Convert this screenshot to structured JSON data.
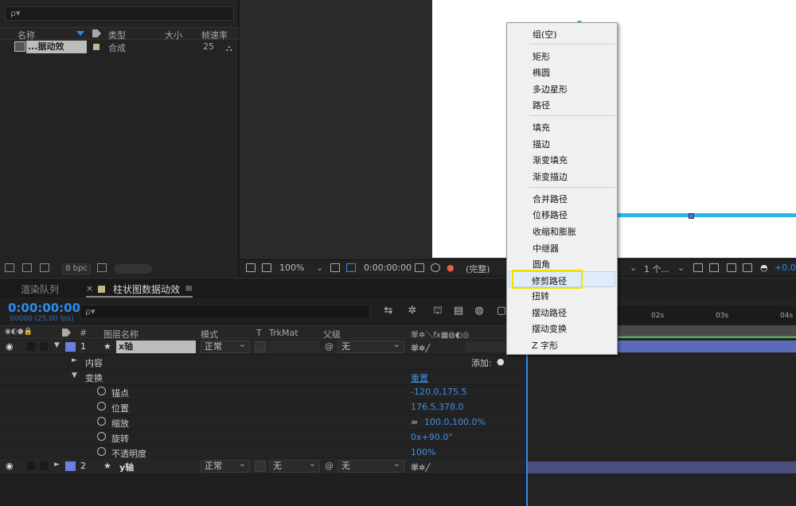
{
  "project": {
    "search_placeholder": "ρ▾",
    "headers": {
      "name": "名称",
      "type": "类型",
      "size": "大小",
      "fps": "帧速率"
    },
    "item": {
      "name": "...据动效",
      "type": "合成",
      "fps": "25"
    },
    "bpc": "8 bpc"
  },
  "viewer_toolbar": {
    "zoom": "100%",
    "timecode": "0:00:00:00",
    "quality": "(完整)",
    "views": "1 个...",
    "exposure": "+0.0"
  },
  "timeline": {
    "tab_render_queue": "渲染队列",
    "tab_comp": "柱状图数据动效",
    "timecode": "0:00:00:00",
    "fps": "00000 (25.00 fps)",
    "search_placeholder": "ρ▾",
    "headers": {
      "num": "#",
      "layer_name": "图层名称",
      "mode": "模式",
      "t": "T",
      "trkmat": "TrkMat",
      "parent": "父级"
    },
    "ruler": [
      "02s",
      "03s",
      "04s"
    ],
    "add_label": "添加:",
    "reset_label": "重置",
    "layers": [
      {
        "num": "1",
        "name": "x轴",
        "mode": "正常",
        "parent": "无"
      },
      {
        "num": "2",
        "name": "y轴",
        "mode": "正常",
        "trkmat": "无",
        "parent": "无"
      }
    ],
    "props": {
      "contents": "内容",
      "transform": "变换",
      "anchor": {
        "label": "锚点",
        "value": "-120.0,175.5"
      },
      "position": {
        "label": "位置",
        "value": "176.5,378.0"
      },
      "scale": {
        "label": "缩放",
        "value": "100.0,100.0%"
      },
      "rotation": {
        "label": "旋转",
        "value": "0x+90.0°"
      },
      "opacity": {
        "label": "不透明度",
        "value": "100%"
      }
    }
  },
  "menu": {
    "items": [
      "组(空)",
      "矩形",
      "椭圆",
      "多边星形",
      "路径",
      "填充",
      "描边",
      "渐变填充",
      "渐变描边",
      "合并路径",
      "位移路径",
      "收缩和膨胀",
      "中继器",
      "圆角",
      "修剪路径",
      "扭转",
      "摆动路径",
      "摆动变换",
      "Z 字形"
    ],
    "highlighted": "修剪路径"
  },
  "colors": {
    "accent": "#2d8ceb",
    "label_blue": "#6a7fe0",
    "highlight": "#f0e000",
    "stroke": "#29b6e8"
  }
}
